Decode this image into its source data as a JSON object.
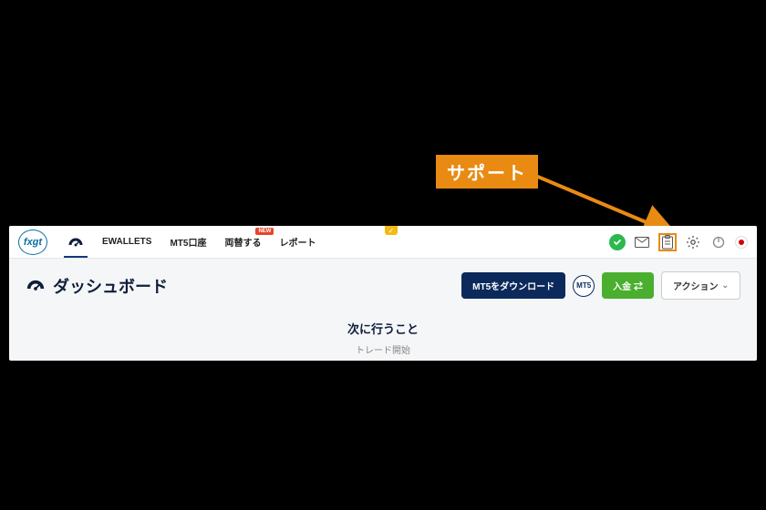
{
  "callout": {
    "label": "サポート"
  },
  "logo": "fxgt",
  "nav": {
    "dashboard_icon": "dashboard-gauge-icon",
    "items": [
      {
        "label": "EWALLETS"
      },
      {
        "label": "MT5口座"
      },
      {
        "label": "両替する",
        "badge": "NEW"
      },
      {
        "label": "レポート"
      }
    ]
  },
  "topright": {
    "status": "verified",
    "mail_icon": "mail-icon",
    "support_icon": "clipboard-icon",
    "gear_icon": "gear-icon",
    "power_icon": "power-icon",
    "lang": "ja"
  },
  "page": {
    "title": "ダッシュボード",
    "mt5_download": "MT5をダウンロード",
    "mt5_badge": "MT5",
    "deposit": "入金 ⇄",
    "action": "アクション",
    "next_title": "次に行うこと",
    "next_sub": "トレード開始"
  }
}
